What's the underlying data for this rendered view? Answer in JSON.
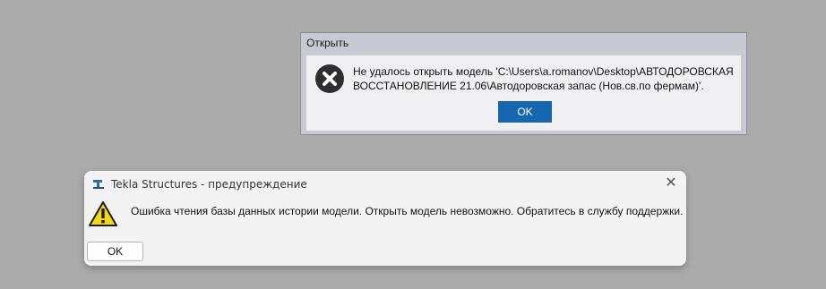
{
  "open_dialog": {
    "title": "Открыть",
    "message": "Не удалось открыть модель 'C:\\Users\\a.romanov\\Desktop\\АВТОДОРОВСКАЯ ВОССТАНОВЛЕНИЕ 21.06\\Автодоровская запас (Нов.св.по фермам)'.",
    "ok_label": "OK",
    "icon": "error-icon",
    "accent_color": "#1766b0"
  },
  "warning_dialog": {
    "title": "Tekla Structures - предупреждение",
    "message": "Ошибка чтения базы данных истории модели. Открыть модель невозможно. Обратитесь в службу поддержки.",
    "ok_label": "OK",
    "icon": "warning-icon",
    "app_icon": "tekla-icon",
    "close_icon": "close-icon"
  }
}
